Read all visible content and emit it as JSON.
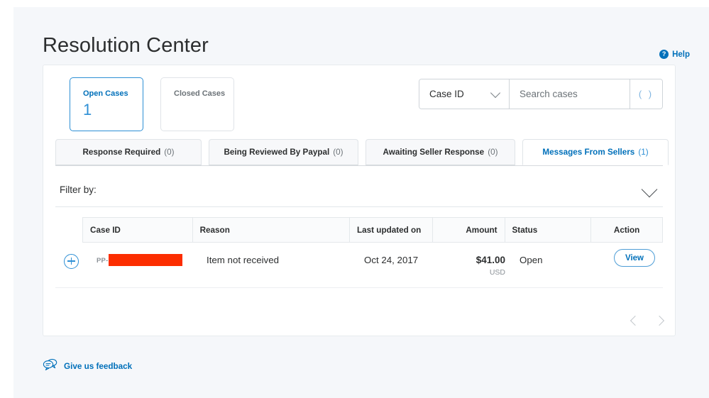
{
  "header": {
    "title": "Resolution Center",
    "help_label": "Help",
    "help_icon": "question-circle-icon"
  },
  "summary": {
    "cards": [
      {
        "label": "Open Cases",
        "count": "1",
        "selected": true
      },
      {
        "label": "Closed Cases",
        "count": "",
        "selected": false
      }
    ]
  },
  "search": {
    "select_value": "Case ID",
    "placeholder": "Search cases",
    "value": "",
    "button_icon": "search-icon",
    "button_glyph": "( )"
  },
  "tabs": [
    {
      "label": "Response Required",
      "count": "(0)",
      "active": false
    },
    {
      "label": "Being Reviewed By Paypal",
      "count": "(0)",
      "active": false
    },
    {
      "label": "Awaiting Seller Response",
      "count": "(0)",
      "active": false
    },
    {
      "label": "Messages From Sellers",
      "count": "(1)",
      "active": true
    }
  ],
  "filter": {
    "label": "Filter by:",
    "caret_icon": "chevron-down-icon"
  },
  "table": {
    "columns": [
      "Case ID",
      "Reason",
      "Last updated on",
      "Amount",
      "Status",
      "Action"
    ],
    "rows": [
      {
        "case_id_prefix": "PP-",
        "case_id_redacted": true,
        "reason": "Item not received",
        "last_updated_on": "Oct 24, 2017",
        "amount": "$41.00",
        "currency": "USD",
        "status": "Open",
        "action": "View"
      }
    ]
  },
  "pagination": {
    "prev_icon": "chevron-left-icon",
    "next_icon": "chevron-right-icon"
  },
  "footer": {
    "feedback_label": "Give us feedback",
    "feedback_icon": "speech-bubbles-icon"
  },
  "colors": {
    "brand_blue": "#0070ba",
    "accent_blue": "#2d8fd5",
    "page_bg": "#f5f7fa",
    "redaction": "#fc2d00"
  }
}
